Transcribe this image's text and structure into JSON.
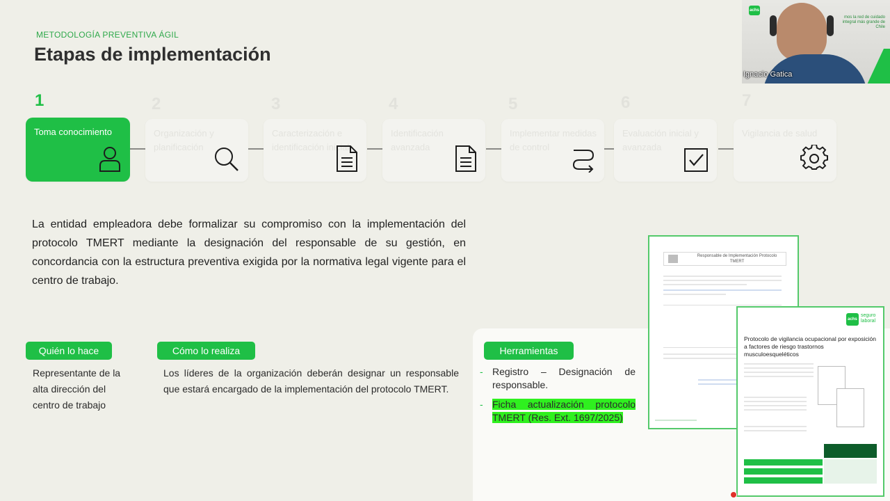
{
  "header": {
    "kicker": "METODOLOGÍA PREVENTIVA ÁGIL",
    "title": "Etapas de implementación"
  },
  "steps": [
    {
      "number": "1",
      "label": "Toma conocimiento",
      "icon": "user-icon",
      "active": true
    },
    {
      "number": "2",
      "label": "Organización y planificación",
      "icon": "search-icon",
      "active": false
    },
    {
      "number": "3",
      "label": "Caracterización e identificación inicial",
      "icon": "document-icon",
      "active": false
    },
    {
      "number": "4",
      "label": "Identificación avanzada",
      "icon": "document-icon",
      "active": false
    },
    {
      "number": "5",
      "label": "Implementar medidas de control",
      "icon": "route-arrows-icon",
      "active": false
    },
    {
      "number": "6",
      "label": "Evaluación inicial y avanzada",
      "icon": "checkbox-icon",
      "active": false
    },
    {
      "number": "7",
      "label": "Vigilancia de salud",
      "icon": "gear-icon",
      "active": false
    }
  ],
  "paragraph": "La entidad empleadora debe formalizar su compromiso con la implementación del protocolo TMERT mediante la designación del responsable de su gestión, en concordancia con la estructura preventiva exigida por la normativa legal vigente para el centro de trabajo.",
  "who": {
    "label": "Quién lo hace",
    "text": "Representante de la alta dirección del centro de trabajo"
  },
  "how": {
    "label": "Cómo lo realiza",
    "text": "Los líderes de la organización deberán designar un responsable que estará encargado de la implementación del protocolo TMERT."
  },
  "tools": {
    "label": "Herramientas",
    "items": [
      "Registro – Designación de responsable.",
      "Ficha actualización protocolo TMERT (Res. Ext. 1697/2025)"
    ]
  },
  "doc1": {
    "heading": "Responsable de Implementación Protocolo TMERT"
  },
  "doc2": {
    "brand": "achs",
    "brand_sub": "seguro laboral",
    "title": "Protocolo de vigilancia ocupacional por exposición a factores de riesgo trastornos musculoesqueléticos"
  },
  "video": {
    "name": "Ignacio Gatica",
    "overlay_text": "mos la red de cuidado integral más grande de Chile",
    "brand": "achs"
  },
  "colors": {
    "accent": "#1fbf46",
    "highlight": "#2ff01f",
    "background": "#efefe8"
  }
}
